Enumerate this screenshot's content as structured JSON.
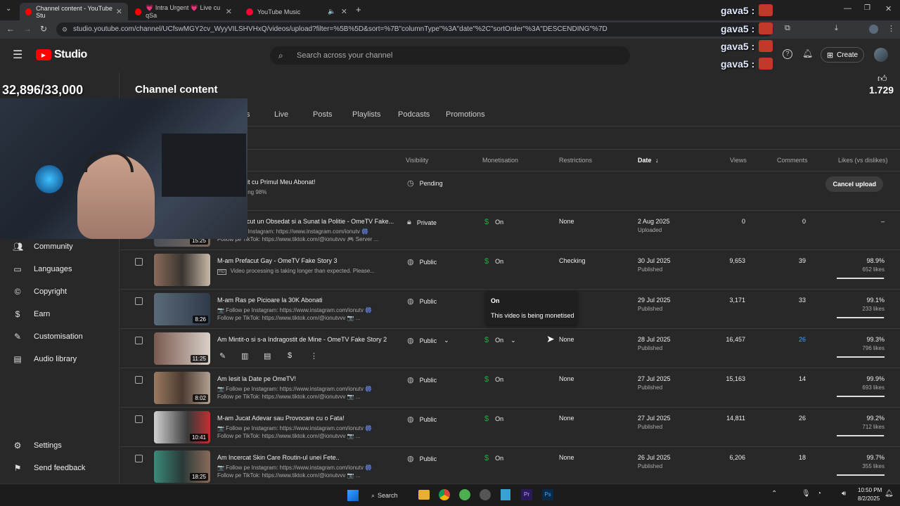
{
  "browser": {
    "tabs": [
      {
        "title": "Channel content - YouTube Stu",
        "active": true
      },
      {
        "title": "💗 Intra Urgent 💗 Live cu qSa",
        "active": false
      },
      {
        "title": "YouTube Music",
        "active": false
      }
    ],
    "url": "studio.youtube.com/channel/UCfswMGY2cv_WyyVILSHVHxQ/videos/upload?filter=%5B%5D&sort=%7B\"columnType\"%3A\"date\"%2C\"sortOrder\"%3A\"DESCENDING\"%7D"
  },
  "studio": {
    "logo_text": "Studio",
    "search_placeholder": "Search across your channel",
    "create_label": "Create",
    "page_title": "Channel content",
    "tabs": [
      "s",
      "Live",
      "Posts",
      "Playlists",
      "Podcasts",
      "Promotions"
    ]
  },
  "overlay": {
    "subscriber_counter": "32,896/33,000",
    "like_count": "1.729",
    "chat_lines": [
      "gava5 :",
      "gava5 :",
      "gava5 :",
      "gava5 :"
    ]
  },
  "sidebar": {
    "items": [
      {
        "label": "Community",
        "icon": "community-icon"
      },
      {
        "label": "Languages",
        "icon": "languages-icon"
      },
      {
        "label": "Copyright",
        "icon": "copyright-icon"
      },
      {
        "label": "Earn",
        "icon": "earn-icon"
      },
      {
        "label": "Customisation",
        "icon": "customisation-icon"
      },
      {
        "label": "Audio library",
        "icon": "audio-library-icon"
      }
    ],
    "bottom": [
      {
        "label": "Settings",
        "icon": "settings-icon"
      },
      {
        "label": "Send feedback",
        "icon": "feedback-icon"
      }
    ]
  },
  "table": {
    "columns": {
      "visibility": "Visibility",
      "monetisation": "Monetisation",
      "restrictions": "Restrictions",
      "date": "Date",
      "views": "Views",
      "comments": "Comments",
      "likes": "Likes (vs dislikes)"
    },
    "cancel_upload": "Cancel upload",
    "tooltip": {
      "title": "On",
      "body": "This video is being monetised"
    },
    "rows": [
      {
        "title": "nit cu Primul Meu Abonat!",
        "desc1": "ding 98%",
        "desc2": "",
        "duration": "",
        "visibility": "Pending",
        "monetisation": "",
        "restrictions": "",
        "date": "",
        "date_sub": "",
        "views": "",
        "comments": "",
        "likes": "",
        "likes_sub": "",
        "like_ratio": 0
      },
      {
        "title": "ocut un Obsedat si a Sunat la Politie - OmeTV Fake...",
        "desc1": "e Instagram: https://www.instagram.com/ionutv 🎆",
        "desc2": "Follow pe TikTok: https://www.tiktok.com/@ionutvvv 🎮 Server ...",
        "duration": "15:25",
        "visibility": "Private",
        "monetisation": "On",
        "restrictions": "None",
        "date": "2 Aug 2025",
        "date_sub": "Uploaded",
        "views": "0",
        "comments": "0",
        "likes": "–",
        "likes_sub": "",
        "like_ratio": 0
      },
      {
        "title": "M-am Prefacut Gay - OmeTV Fake Story 3",
        "desc1": "Video processing is taking longer than expected. Please...",
        "desc2": "",
        "duration": "",
        "visibility": "Public",
        "monetisation": "On",
        "restrictions": "Checking",
        "date": "30 Jul 2025",
        "date_sub": "Published",
        "views": "9,653",
        "comments": "39",
        "likes": "98.9%",
        "likes_sub": "652 likes",
        "like_ratio": 0.989
      },
      {
        "title": "M-am Ras pe Picioare la 30K Abonati",
        "desc1": "📷 Follow pe Instagram: https://www.instagram.com/ionutv 🎆",
        "desc2": "Follow pe TikTok: https://www.tiktok.com/@ionutvvv 📷 ...",
        "duration": "8:26",
        "visibility": "Public",
        "monetisation": "",
        "restrictions": "",
        "date": "29 Jul 2025",
        "date_sub": "Published",
        "views": "3,171",
        "comments": "33",
        "likes": "99.1%",
        "likes_sub": "233 likes",
        "like_ratio": 0.991
      },
      {
        "title": "Am Mintit-o si s-a Indragostit de Mine - OmeTV Fake Story 2",
        "desc1": "",
        "desc2": "",
        "duration": "11:25",
        "visibility": "Public",
        "monetisation": "On",
        "restrictions": "None",
        "date": "28 Jul 2025",
        "date_sub": "Published",
        "views": "16,457",
        "comments": "26",
        "likes": "99.3%",
        "likes_sub": "796 likes",
        "like_ratio": 0.993
      },
      {
        "title": "Am Iesit la Date pe OmeTV!",
        "desc1": "📷 Follow pe Instagram: https://www.instagram.com/ionutv 🎆",
        "desc2": "Follow pe TikTok: https://www.tiktok.com/@ionutvvv 📷 ...",
        "duration": "8:02",
        "visibility": "Public",
        "monetisation": "On",
        "restrictions": "None",
        "date": "27 Jul 2025",
        "date_sub": "Published",
        "views": "15,163",
        "comments": "14",
        "likes": "99.9%",
        "likes_sub": "693 likes",
        "like_ratio": 0.999
      },
      {
        "title": "M-am Jucat Adevar sau Provocare cu o Fata!",
        "desc1": "📷 Follow pe Instagram: https://www.instagram.com/ionutv 🎆",
        "desc2": "Follow pe TikTok: https://www.tiktok.com/@ionutvvv 📷 ...",
        "duration": "10:41",
        "visibility": "Public",
        "monetisation": "On",
        "restrictions": "None",
        "date": "27 Jul 2025",
        "date_sub": "Published",
        "views": "14,811",
        "comments": "26",
        "likes": "99.2%",
        "likes_sub": "712 likes",
        "like_ratio": 0.992
      },
      {
        "title": "Am Incercat Skin Care Routin-ul unei Fete..",
        "desc1": "📷 Follow pe Instagram: https://www.instagram.com/ionutv 🎆",
        "desc2": "Follow pe TikTok: https://www.tiktok.com/@ionutvvv 📷 ...",
        "duration": "18:25",
        "visibility": "Public",
        "monetisation": "On",
        "restrictions": "None",
        "date": "26 Jul 2025",
        "date_sub": "Published",
        "views": "6,206",
        "comments": "18",
        "likes": "99.7%",
        "likes_sub": "355 likes",
        "like_ratio": 0.997
      }
    ]
  },
  "taskbar": {
    "search_label": "Search",
    "time": "10:50 PM",
    "date": "8/2/2025"
  },
  "colors": {
    "accent_red": "#ff0000",
    "monetisation_green": "#2ba640",
    "link_blue": "#3ea6ff"
  }
}
